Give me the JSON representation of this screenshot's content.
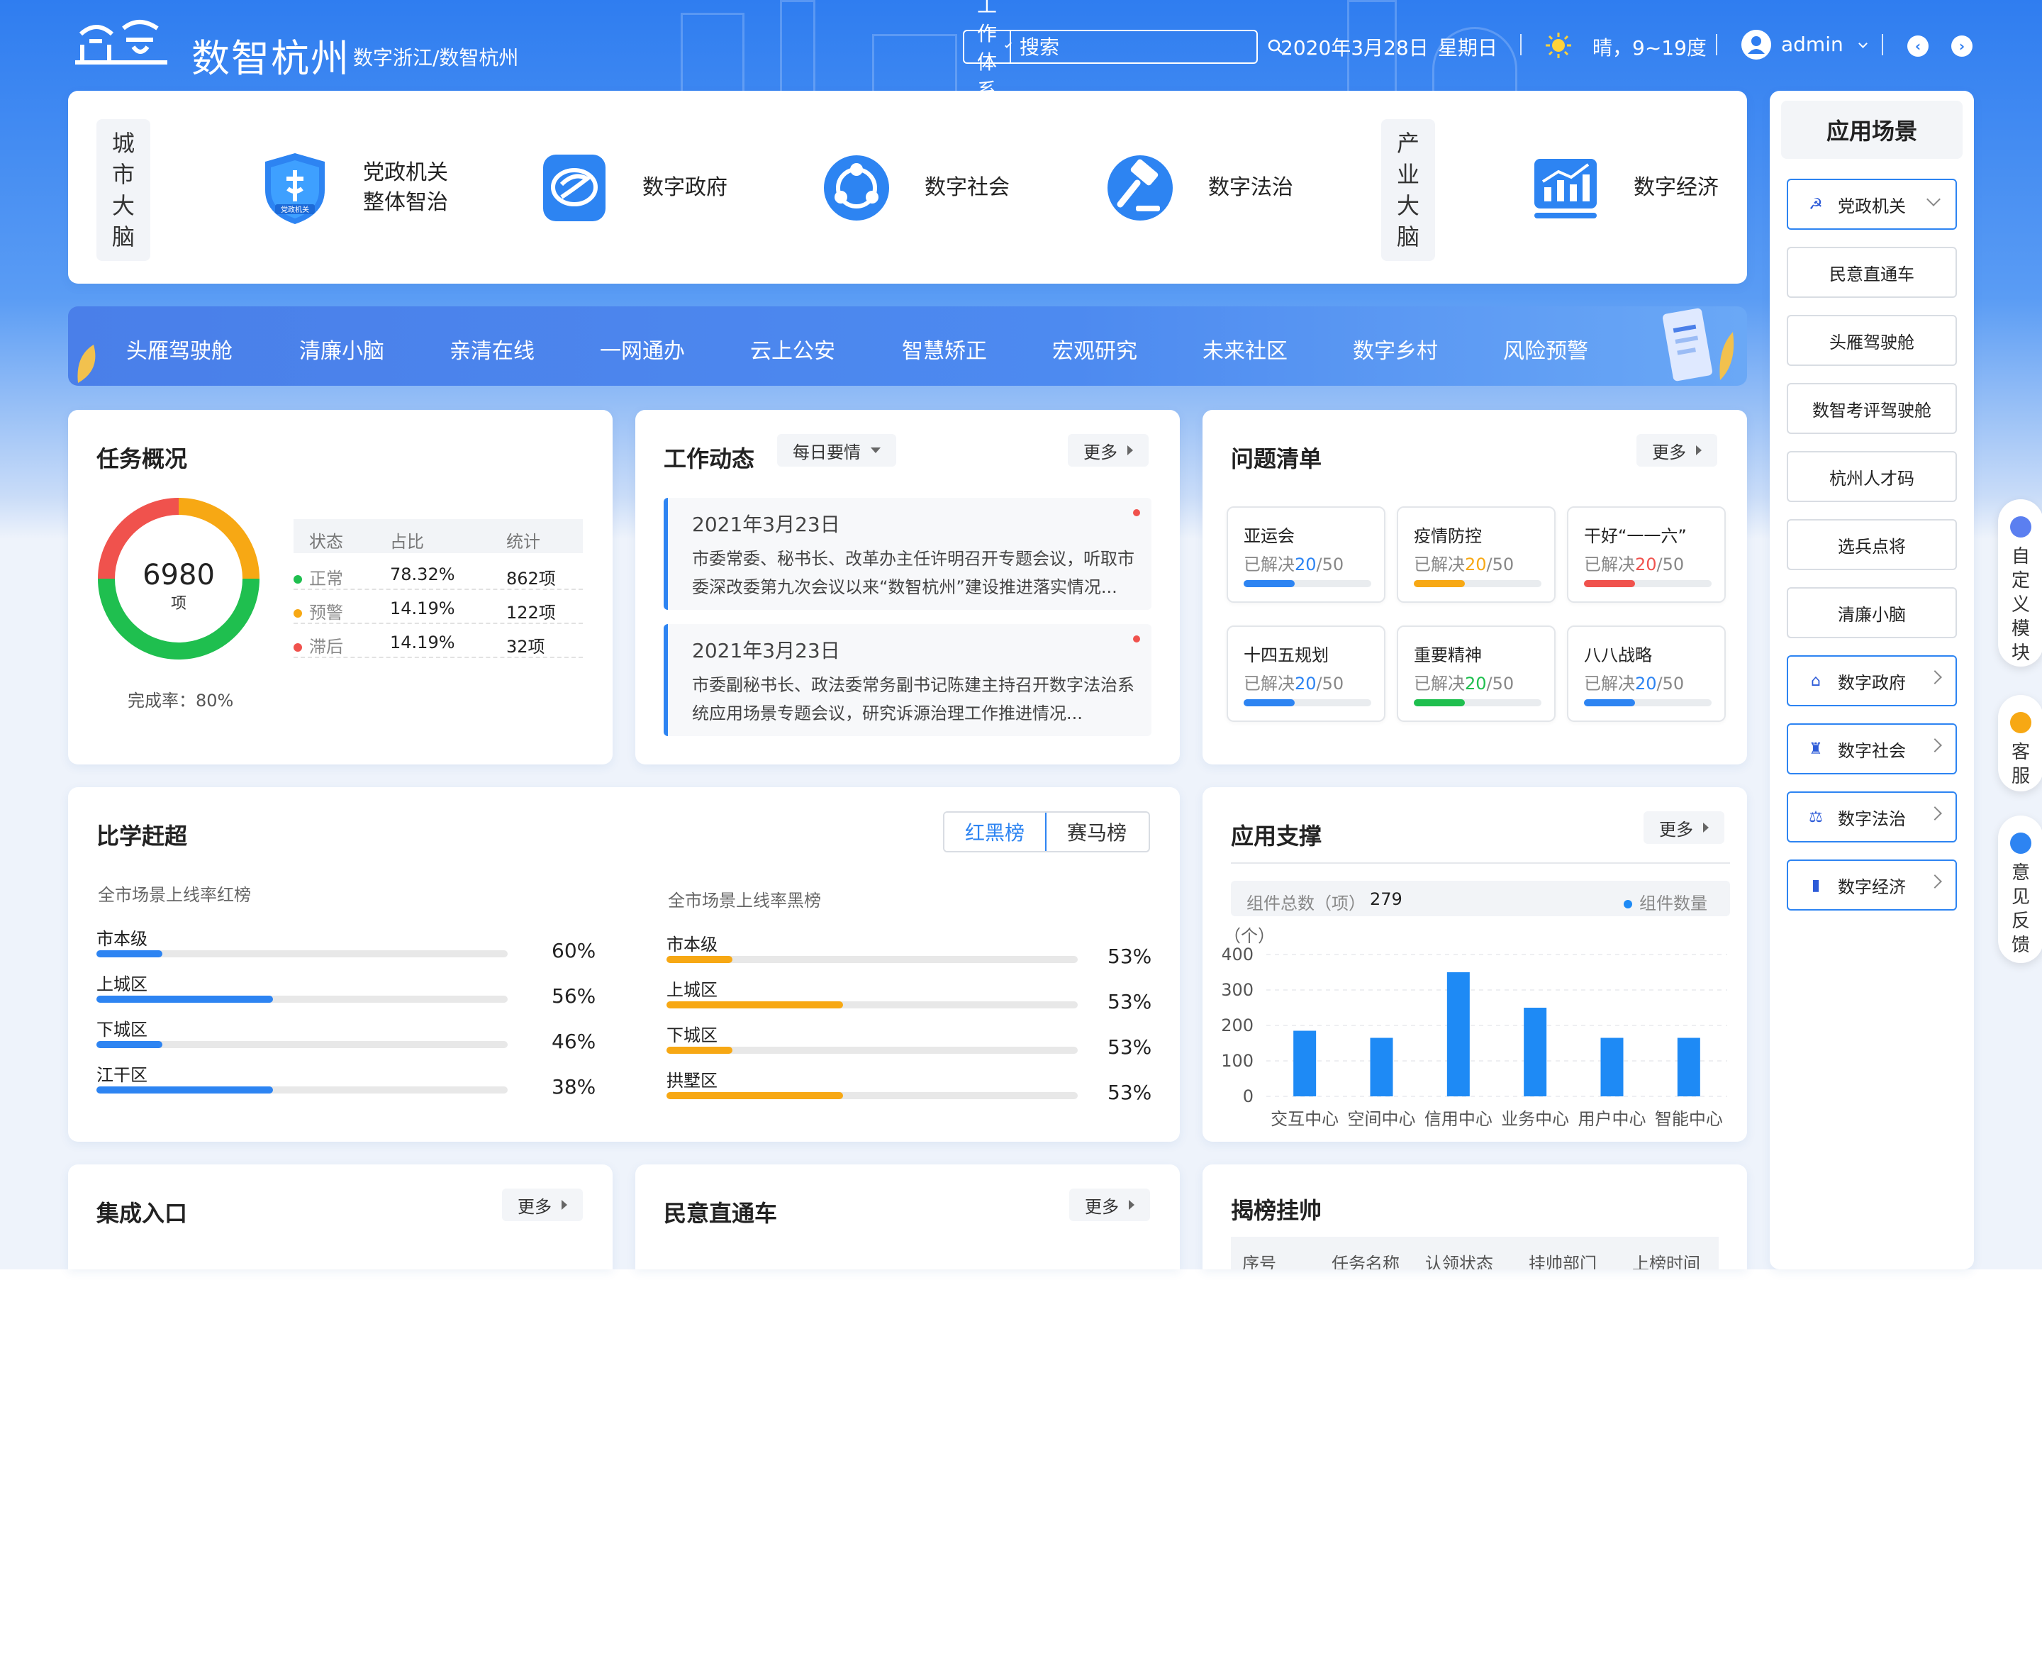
{
  "header": {
    "brand": "数智杭州",
    "brand_sub": "数字浙江/数智杭州",
    "search_select": "工作体系",
    "search_placeholder": "搜索",
    "date": "2020年3月28日",
    "weekday": "星期日",
    "weather": "晴，9~19度",
    "user": "admin"
  },
  "brain": {
    "city_label": [
      "城",
      "市",
      "大",
      "脑"
    ],
    "industry_label": [
      "产",
      "业",
      "大",
      "脑"
    ],
    "items": [
      {
        "label_1": "党政机关",
        "label_2": "整体智治",
        "icon_text": "党政机关"
      },
      {
        "label_1": "数字政府"
      },
      {
        "label_1": "数字社会"
      },
      {
        "label_1": "数字法治"
      },
      {
        "label_1": "数字经济"
      }
    ]
  },
  "nav": [
    "头雁驾驶舱",
    "清廉小脑",
    "亲清在线",
    "一网通办",
    "云上公安",
    "智慧矫正",
    "宏观研究",
    "未来社区",
    "数字乡村",
    "风险预警"
  ],
  "tasks": {
    "title": "任务概况",
    "total": "6980",
    "unit": "项",
    "headers": [
      "状态",
      "占比",
      "统计"
    ],
    "rows": [
      {
        "status": "正常",
        "ratio": "78.32%",
        "count": "862项",
        "color": "#1fbf4f"
      },
      {
        "status": "预警",
        "ratio": "14.19%",
        "count": "122项",
        "color": "#f7a814"
      },
      {
        "status": "滞后",
        "ratio": "14.19%",
        "count": "32项",
        "color": "#f0524d"
      }
    ],
    "completion": "完成率：80%",
    "donut_share": [
      0.5,
      0.25,
      0.25
    ]
  },
  "work": {
    "title": "工作动态",
    "filter": "每日要情",
    "more": "更多",
    "news": [
      {
        "date": "2021年3月23日",
        "text": "市委常委、秘书长、改革办主任许明召开专题会议，听取市委深改委第九次会议以来“数智杭州”建设推进落实情况..."
      },
      {
        "date": "2021年3月23日",
        "text": "市委副秘书长、政法委常务副书记陈建主持召开数字法治系统应用场景专题会议，研究诉源治理工作推进情况..."
      }
    ]
  },
  "issues": {
    "title": "问题清单",
    "more": "更多",
    "prefix": "已解决",
    "total": "/50",
    "items": [
      {
        "name": "亚运会",
        "done": "20",
        "color": "#2d84f2",
        "fill": 0.4
      },
      {
        "name": "疫情防控",
        "done": "20",
        "color": "#f7a814",
        "fill": 0.4
      },
      {
        "name": "干好“一一六”",
        "done": "20",
        "color": "#f0524d",
        "fill": 0.4
      },
      {
        "name": "十四五规划",
        "done": "20",
        "color": "#2d84f2",
        "fill": 0.4
      },
      {
        "name": "重要精神",
        "done": "20",
        "color": "#1fbf4f",
        "fill": 0.4
      },
      {
        "name": "八八战略",
        "done": "20",
        "color": "#2d84f2",
        "fill": 0.4
      }
    ]
  },
  "ranking": {
    "title": "比学赶超",
    "tab_on": "红黑榜",
    "tab_off": "赛马榜",
    "red_title": "全市场景上线率红榜",
    "black_title": "全市场景上线率黑榜",
    "red": [
      {
        "name": "市本级",
        "value": "60%",
        "fill": 0.16
      },
      {
        "name": "上城区",
        "value": "56%",
        "fill": 0.43
      },
      {
        "name": "下城区",
        "value": "46%",
        "fill": 0.16
      },
      {
        "name": "江干区",
        "value": "38%",
        "fill": 0.43
      }
    ],
    "black": [
      {
        "name": "市本级",
        "value": "53%",
        "fill": 0.16
      },
      {
        "name": "上城区",
        "value": "53%",
        "fill": 0.43
      },
      {
        "name": "下城区",
        "value": "53%",
        "fill": 0.16
      },
      {
        "name": "拱墅区",
        "value": "53%",
        "fill": 0.43
      }
    ],
    "red_color": "#2d84f2",
    "black_color": "#f7a814"
  },
  "support": {
    "title": "应用支撑",
    "more": "更多",
    "summary_label": "组件总数（项）",
    "summary_value": "279",
    "legend": "组件数量",
    "chart_data": {
      "type": "bar",
      "categories": [
        "交互中心",
        "空间中心",
        "信用中心",
        "业务中心",
        "用户中心",
        "智能中心"
      ],
      "values": [
        185,
        165,
        350,
        250,
        165,
        165
      ],
      "ylabel": "（个）",
      "ylim": [
        0,
        400
      ],
      "yticks": [
        "400",
        "300",
        "200",
        "100",
        "0"
      ],
      "color": "#1e8af5"
    }
  },
  "bottom": {
    "integration": {
      "title": "集成入口",
      "more": "更多"
    },
    "voice": {
      "title": "民意直通车",
      "more": "更多"
    },
    "leader": {
      "title": "揭榜挂帅",
      "headers": [
        "序号",
        "任务名称",
        "认领状态",
        "挂帅部门",
        "上榜时间"
      ]
    }
  },
  "side": {
    "title": "应用场景",
    "buttons": [
      {
        "label": "党政机关",
        "style": "blue",
        "icon": "☭",
        "arrow": "down"
      },
      {
        "label": "民意直通车"
      },
      {
        "label": "头雁驾驶舱"
      },
      {
        "label": "数智考评驾驶舱"
      },
      {
        "label": "杭州人才码"
      },
      {
        "label": "选兵点将"
      },
      {
        "label": "清廉小脑"
      },
      {
        "label": "数字政府",
        "style": "blue",
        "icon": "⌂",
        "arrow": "right"
      },
      {
        "label": "数字社会",
        "style": "blue",
        "icon": "♜",
        "arrow": "right"
      },
      {
        "label": "数字法治",
        "style": "blue",
        "icon": "⚖",
        "arrow": "right"
      },
      {
        "label": "数字经济",
        "style": "blue",
        "icon": "▮",
        "arrow": "right"
      }
    ]
  },
  "floats": [
    {
      "label": [
        "自",
        "定",
        "义",
        "模",
        "块"
      ],
      "color": "#5b7ff0"
    },
    {
      "label": [
        "客",
        "服"
      ],
      "color": "#f7a814"
    },
    {
      "label": [
        "意",
        "见",
        "反",
        "馈"
      ],
      "color": "#2d84f2"
    }
  ]
}
